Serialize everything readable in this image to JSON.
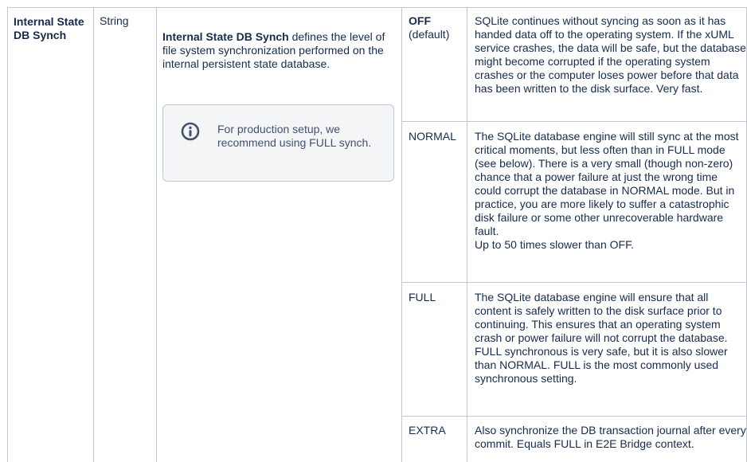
{
  "param": {
    "name": "Internal State DB Synch",
    "type": "String",
    "description_term": "Internal State DB Synch",
    "description_rest": " defines the level of file system synchronization performed on the internal persistent state database."
  },
  "info_panel": {
    "icon": "info-icon",
    "text": "For production setup, we recommend using FULL synch."
  },
  "options": [
    {
      "value": "OFF",
      "note": "(default)",
      "description": "SQLite continues without syncing as soon as it has handed data off to the operating system. If the xUML service crashes, the data will be safe, but the database might become corrupted if the operating system crashes or the computer loses power before that data has been written to the disk surface. Very fast."
    },
    {
      "value": "NORMAL",
      "description": "The SQLite database engine will still sync at the most critical moments, but less often than in FULL mode (see below). There is a very small (though non-zero) chance that a power failure at just the wrong time could corrupt the database in NORMAL mode. But in practice, you are more likely to suffer a catastrophic disk failure or some other unrecoverable hardware fault.",
      "extra": "Up to 50 times slower than OFF."
    },
    {
      "value": "FULL",
      "description": "The SQLite database engine will ensure that all content is safely written to the disk surface prior to continuing. This ensures that an operating system crash or power failure will not corrupt the database. FULL synchronous is very safe, but it is also slower than NORMAL. FULL is the most commonly used synchronous setting."
    },
    {
      "value": "EXTRA",
      "description": "Also synchronize the DB transaction journal after every commit. Equals FULL in E2E Bridge context."
    }
  ]
}
